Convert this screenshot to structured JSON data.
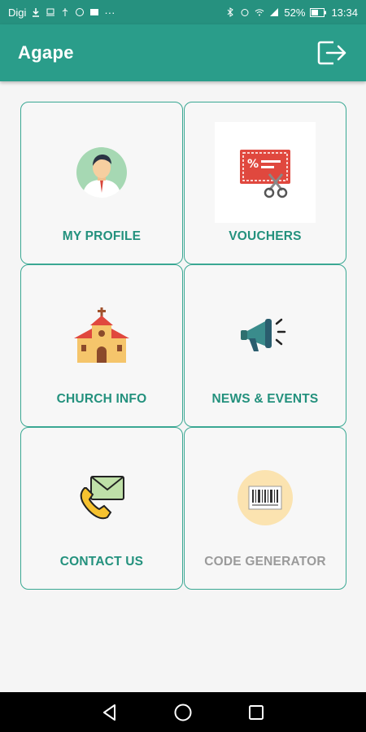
{
  "status_bar": {
    "carrier": "Digi",
    "battery": "52%",
    "time": "13:34"
  },
  "app_bar": {
    "title": "Agape",
    "logout_icon": "logout-icon"
  },
  "tiles": [
    {
      "label": "MY PROFILE",
      "icon": "profile-avatar-icon",
      "enabled": true
    },
    {
      "label": "VOUCHERS",
      "icon": "voucher-scissors-icon",
      "enabled": true
    },
    {
      "label": "CHURCH INFO",
      "icon": "church-icon",
      "enabled": true
    },
    {
      "label": "NEWS & EVENTS",
      "icon": "megaphone-icon",
      "enabled": true
    },
    {
      "label": "CONTACT US",
      "icon": "phone-mail-icon",
      "enabled": true
    },
    {
      "label": "CODE GENERATOR",
      "icon": "barcode-icon",
      "enabled": false
    }
  ],
  "nav_bar": {
    "back_icon": "back-triangle-icon",
    "home_icon": "home-circle-icon",
    "recents_icon": "recents-square-icon"
  },
  "colors": {
    "primary": "#2a9d8a",
    "status_bar": "#26917f",
    "tile_label": "#23917d",
    "disabled_label": "#9a9a9a"
  }
}
